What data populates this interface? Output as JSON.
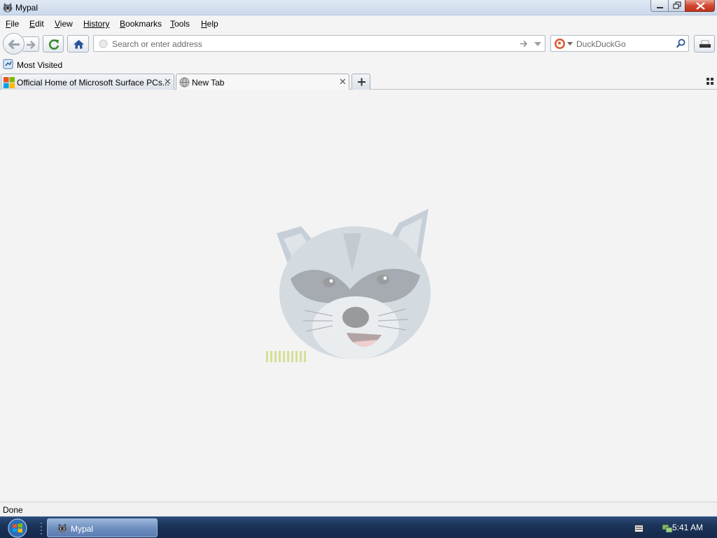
{
  "window": {
    "title": "Mypal"
  },
  "menu": {
    "items": [
      {
        "label": "File",
        "key": "F",
        "rest": "ile"
      },
      {
        "label": "Edit",
        "key": "E",
        "rest": "dit"
      },
      {
        "label": "View",
        "key": "V",
        "rest": "iew"
      },
      {
        "label": "History",
        "key": "",
        "rest": "History"
      },
      {
        "label": "Bookmarks",
        "key": "B",
        "rest": "ookmarks"
      },
      {
        "label": "Tools",
        "key": "T",
        "rest": "ools"
      },
      {
        "label": "Help",
        "key": "H",
        "rest": "elp"
      }
    ]
  },
  "toolbar": {
    "url_placeholder": "Search or enter address",
    "search_engine": "DuckDuckGo"
  },
  "bookmarks": {
    "items": [
      {
        "label": "Most Visited"
      }
    ]
  },
  "tabs": [
    {
      "label": "Official Home of Microsoft Surface PCs...",
      "active": false
    },
    {
      "label": "New Tab",
      "active": true
    }
  ],
  "status": {
    "text": "Done"
  },
  "taskbar": {
    "task_label": "Mypal",
    "clock": "5:41 AM"
  },
  "colors": {
    "close_button": "#c0311a",
    "taskbar": "#1b3459",
    "content_bg": "#f3f3f3"
  }
}
